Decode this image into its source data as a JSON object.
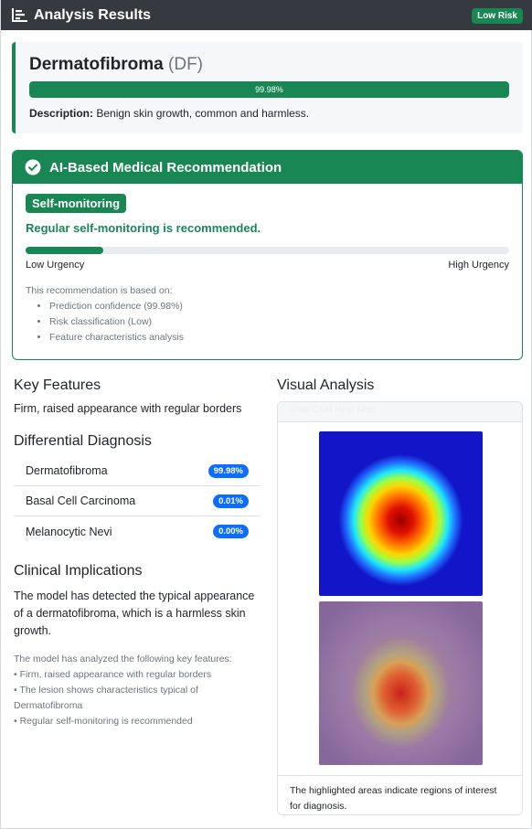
{
  "header": {
    "title": "Analysis Results",
    "risk_badge": "Low Risk"
  },
  "diagnosis": {
    "name": "Dermatofibroma",
    "code": "(DF)",
    "confidence_label": "99.98%",
    "confidence": 0.9998,
    "description_label": "Description:",
    "description": "Benign skin growth, common and harmless."
  },
  "recommendation": {
    "title": "AI-Based Medical Recommendation",
    "badge": "Self-monitoring",
    "text": "Regular self-monitoring is recommended.",
    "urgency_level": 0.16,
    "urgency_low_label": "Low Urgency",
    "urgency_high_label": "High Urgency",
    "basis_intro": "This recommendation is based on:",
    "basis_items": [
      "Prediction confidence (99.98%)",
      "Risk classification (Low)",
      "Feature characteristics analysis"
    ]
  },
  "key_features": {
    "title": "Key Features",
    "text": "Firm, raised appearance with regular borders"
  },
  "differential": {
    "title": "Differential Diagnosis",
    "rows": [
      {
        "name": "Dermatofibroma",
        "value": "99.98%"
      },
      {
        "name": "Basal Cell Carcinoma",
        "value": "0.01%"
      },
      {
        "name": "Melanocytic Nevi",
        "value": "0.00%"
      }
    ]
  },
  "clinical": {
    "title": "Clinical Implications",
    "text": "The model has detected the typical appearance of a dermatofibroma, which is a harmless skin growth.",
    "details_lines": [
      "The model has analyzed the following key features:",
      "• Firm, raised appearance with regular borders",
      "• The lesion shows characteristics typical of Dermatofibroma",
      "• Regular self-monitoring is recommended"
    ]
  },
  "visual": {
    "title": "Visual Analysis",
    "card_header": "Grad-CAM Heat Map",
    "caption": "The highlighted areas indicate regions of interest for diagnosis."
  },
  "colors": {
    "success": "#198754",
    "primary": "#0d6efd",
    "dark": "#343a40"
  },
  "icons": {
    "header": "bar-chart-icon",
    "recommendation": "check-circle-icon"
  }
}
